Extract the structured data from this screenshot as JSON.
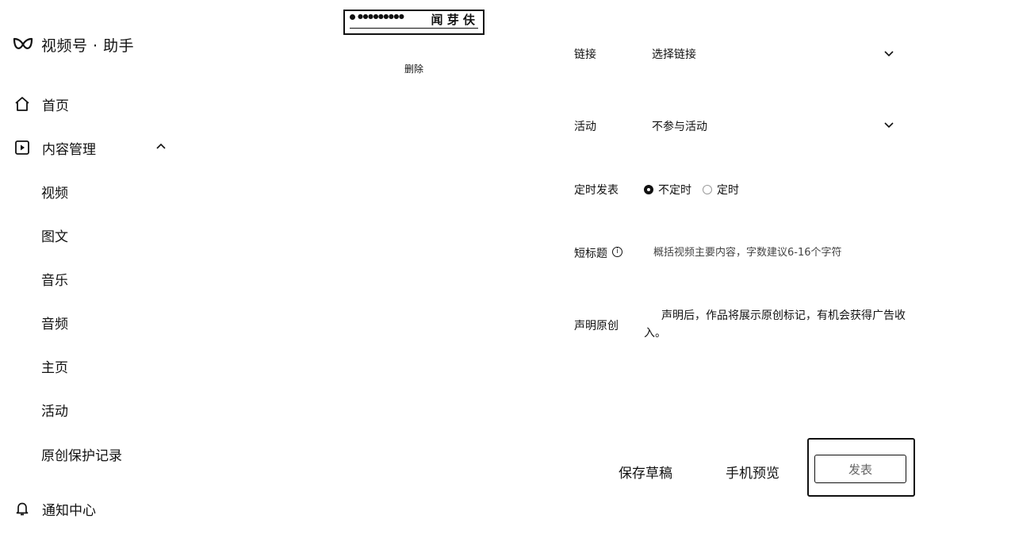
{
  "app": {
    "title": "视频号 · 助手"
  },
  "sidebar": {
    "items": [
      {
        "label": "首页",
        "icon": "home-icon"
      },
      {
        "label": "内容管理",
        "icon": "play-square-icon",
        "expanded": true
      },
      {
        "label": "通知中心",
        "icon": "bell-icon"
      }
    ],
    "sub_items": [
      "视频",
      "图文",
      "音乐",
      "音频",
      "主页",
      "活动",
      "原创保护记录"
    ]
  },
  "cover": {
    "thumb_small_text": "●●●●●●●●●",
    "thumb_big_text": "闻 芽 伕",
    "delete_label": "删除"
  },
  "form": {
    "link": {
      "label": "链接",
      "value": "选择链接"
    },
    "activity": {
      "label": "活动",
      "value": "不参与活动"
    },
    "schedule": {
      "label": "定时发表",
      "options": [
        "不定时",
        "定时"
      ],
      "selected": "不定时"
    },
    "short_title": {
      "label": "短标题",
      "placeholder": "概括视频主要内容，字数建议6-16个字符"
    },
    "original": {
      "label": "声明原创",
      "text": "声明后，作品将展示原创标记，有机会获得广告收入。"
    }
  },
  "actions": {
    "save_draft": "保存草稿",
    "phone_preview": "手机预览",
    "publish": "发表"
  }
}
